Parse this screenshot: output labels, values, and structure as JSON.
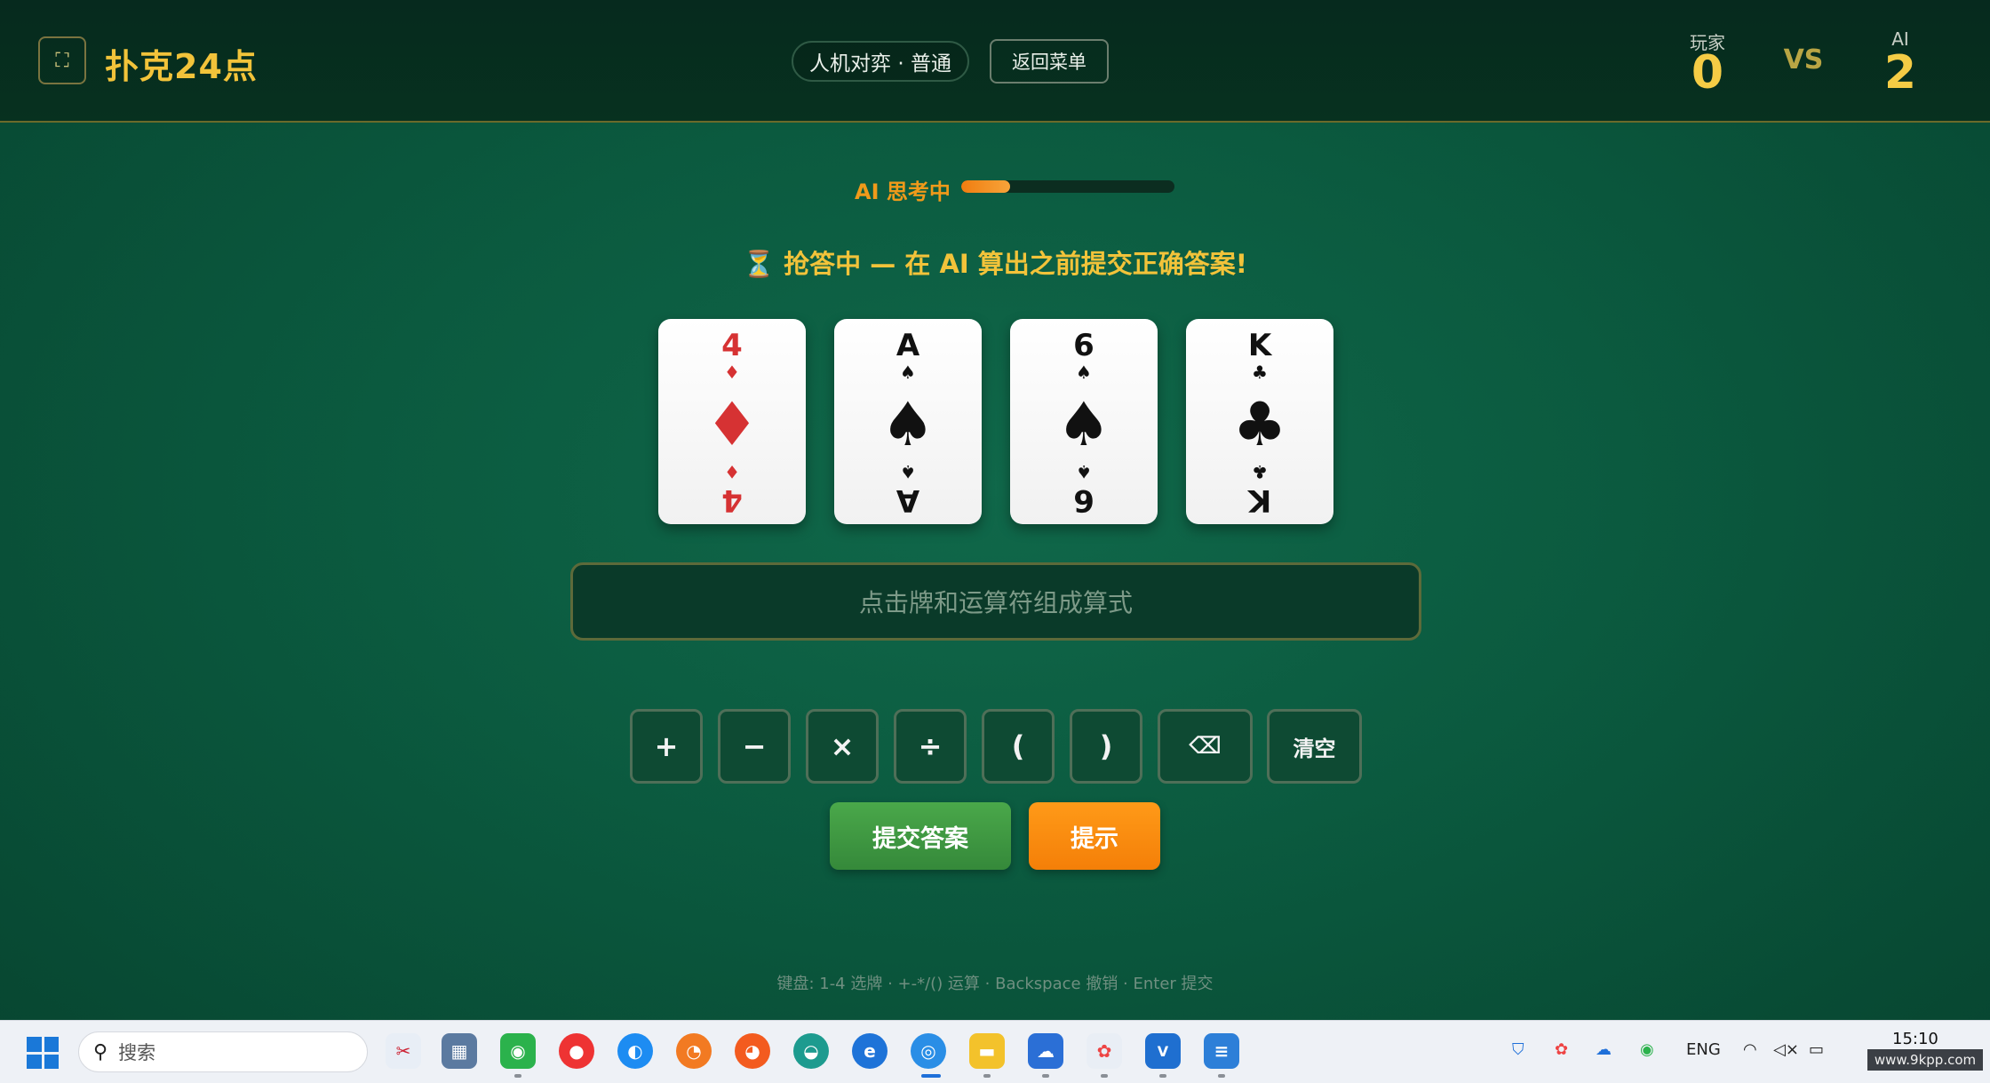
{
  "header": {
    "fullscreen_icon": "fullscreen-icon",
    "title": "扑克24点",
    "mode": "人机对弈 · 普通",
    "back_label": "返回菜单",
    "player_label": "玩家",
    "player_score": "0",
    "vs": "VS",
    "ai_label": "AI",
    "ai_score": "2"
  },
  "status": {
    "thinking_label": "AI 思考中",
    "thinking_progress": 0.23,
    "banner": "⏳ 抢答中 — 在 AI 算出之前提交正确答案!"
  },
  "cards": [
    {
      "rank": "4",
      "suit": "♦",
      "color": "#d63233"
    },
    {
      "rank": "A",
      "suit": "♠",
      "color": "#111111"
    },
    {
      "rank": "6",
      "suit": "♠",
      "color": "#111111"
    },
    {
      "rank": "K",
      "suit": "♣",
      "color": "#111111"
    }
  ],
  "expression": {
    "placeholder": "点击牌和运算符组成算式"
  },
  "operators": {
    "plus": "+",
    "minus": "−",
    "times": "×",
    "divide": "÷",
    "lparen": "(",
    "rparen": ")",
    "backspace": "⌫",
    "clear": "清空"
  },
  "actions": {
    "submit": "提交答案",
    "hint": "提示"
  },
  "keyboard_hint": "键盘: 1-4 选牌 · +-*/() 运算 · Backspace 撤销 · Enter 提交",
  "taskbar": {
    "search_placeholder": "搜索",
    "lang": "ENG",
    "time": "15:10",
    "watermark": "www.9kpp.com"
  },
  "colors": {
    "accent_gold": "#f2c33a",
    "thinking_orange": "#f09a1a",
    "submit_green": "#3f9a41",
    "hint_orange": "#f68b10",
    "table_green": "#0b5a3f"
  }
}
